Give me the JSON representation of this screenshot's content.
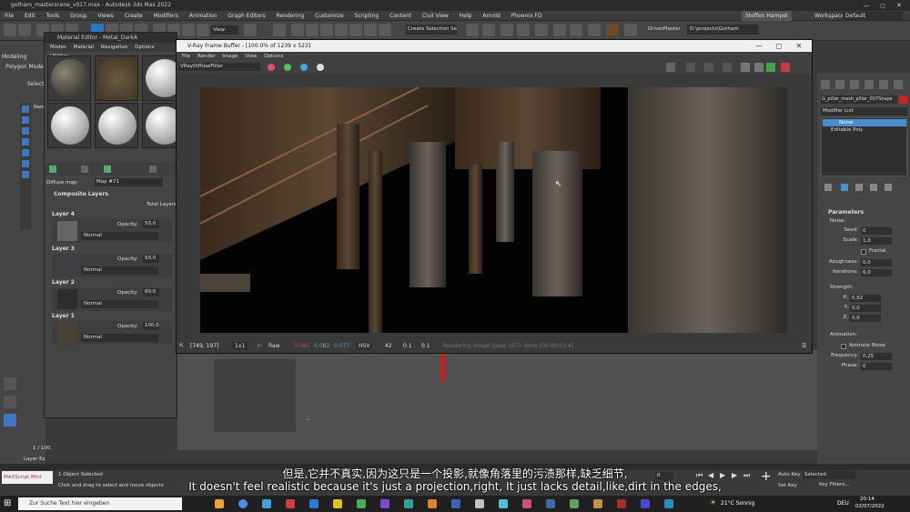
{
  "window": {
    "title": "gotham_masterscene_v017.max - Autodesk 3ds Max 2022",
    "min": "—",
    "max": "◻",
    "close": "✕"
  },
  "menu": [
    "File",
    "Edit",
    "Tools",
    "Group",
    "Views",
    "Create",
    "Modifiers",
    "Animation",
    "Graph Editors",
    "Rendering",
    "Customize",
    "Scripting",
    "Content",
    "Civil View",
    "Help",
    "Arnold",
    "Phoenix FD"
  ],
  "user": "Steffen Hampel",
  "workspaces": {
    "label": "Workspaces:",
    "value": "Default"
  },
  "toolbar": {
    "view_dropdown": "View",
    "selection_set": "Create Selection Se",
    "driver": "DriverMaster",
    "project_path": "D:\\projects\\Gotham"
  },
  "left_tabs": {
    "modeling": "Modeling",
    "polymode": "Polygon Mode",
    "select": "Select",
    "name_col": "Nam"
  },
  "material_editor": {
    "title": "Material Editor - Metal_DarkA",
    "menu": [
      "Modes",
      "Material",
      "Navigation",
      "Options",
      "Utilities"
    ],
    "diffuse_label": "Diffuse map:",
    "map_name": "Map #71",
    "rollout": "Composite Layers",
    "total_layers": "Total Layers",
    "opacity_label": "Opacity:",
    "layers": [
      {
        "name": "Layer 4",
        "opacity": "50,0",
        "blend": "Normal"
      },
      {
        "name": "Layer 3",
        "opacity": "50,0",
        "blend": "Normal"
      },
      {
        "name": "Layer 2",
        "opacity": "60,0",
        "blend": "Normal"
      },
      {
        "name": "Layer 1",
        "opacity": "100,0",
        "blend": "Normal"
      }
    ]
  },
  "vfb": {
    "title": "V-Ray Frame Buffer - [100.0% of 1239 x 523]",
    "menu": [
      "File",
      "Render",
      "Image",
      "View",
      "Options"
    ],
    "channel": "VRayDiffuseFilter",
    "status": {
      "coords": "[749, 197]",
      "zoom": "1x1",
      "mode": "Raw",
      "r": "0.085",
      "g": "0.082",
      "b": "0.077",
      "space": "HSV",
      "v1": "42",
      "v2": "0.1",
      "v3": "0.1",
      "progress": "Rendering image (pass 167): done [00:00:03.4]"
    }
  },
  "command_panel": {
    "object_name": "G_pillar_mesh_pillar_007Shape",
    "modifier_list": "Modifier List",
    "stack": [
      "Noise",
      "Editable Poly"
    ],
    "parameters": "Parameters",
    "noise": "Noise:",
    "seed": {
      "label": "Seed:",
      "value": "0"
    },
    "scale": {
      "label": "Scale:",
      "value": "1,0"
    },
    "fractal": "Fractal",
    "roughness": {
      "label": "Roughness:",
      "value": "0,0"
    },
    "iterations": {
      "label": "Iterations:",
      "value": "6,0"
    },
    "strength": "Strength:",
    "x": {
      "label": "X:",
      "value": "0,02"
    },
    "y": {
      "label": "Y:",
      "value": "0,0"
    },
    "z": {
      "label": "Z:",
      "value": "0,0"
    },
    "animation": "Animation:",
    "animate_noise": "Animate Noise",
    "frequency": {
      "label": "Frequency:",
      "value": "0,25"
    },
    "phase": {
      "label": "Phase:",
      "value": "0"
    }
  },
  "statusbar": {
    "script": "MAXScript Mini",
    "objects": "1 Object Selected",
    "prompt": "Click and drag to select and move objects",
    "frame": "1 / 100",
    "layer_explorer": "Layer Ex",
    "auto_key": "Auto Key",
    "selected": "Selected",
    "set_key": "Set Key",
    "key_filters": "Key Filters...",
    "frame_field": "0"
  },
  "taskbar": {
    "search": "Zur Suche Text hier eingeben",
    "weather": "21°C Sonnig",
    "lang": "DEU",
    "time": "20:14",
    "date": "02/07/2022"
  },
  "subtitles": {
    "zh": "但是,它并不真实,因为这只是一个投影,就像角落里的污渍那样,缺乏细节,",
    "en": "It doesn't feel realistic because it's just a projection,right, It just lacks detail,like,dirt in the edges,"
  }
}
